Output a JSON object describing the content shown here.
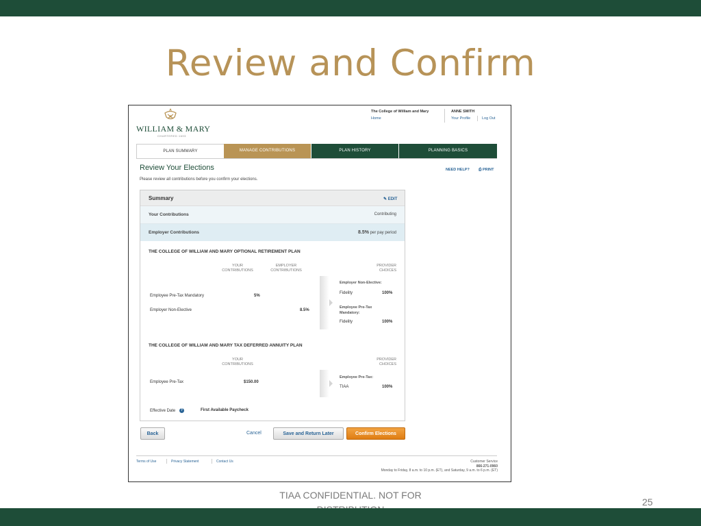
{
  "slide": {
    "title": "Review and Confirm",
    "footer": "TIAA CONFIDENTIAL. NOT FOR DISTRIBUTION",
    "page_number": "25",
    "colors": {
      "green": "#1e4d38",
      "gold": "#b79358",
      "orange": "#df7d12"
    }
  },
  "site": {
    "logo_text": "WILLIAM & MARY",
    "logo_sub": "CHARTERED 1693",
    "institution": "The College of William and Mary",
    "home_link": "Home",
    "user_name": "ANNE SMITH",
    "profile_link": "Your Profile",
    "logout_link": "Log Out"
  },
  "tabs": [
    {
      "label": "PLAN SUMMARY"
    },
    {
      "label": "MANAGE CONTRIBUTIONS"
    },
    {
      "label": "PLAN HISTORY"
    },
    {
      "label": "PLANNING BASICS"
    }
  ],
  "page": {
    "title": "Review Your Elections",
    "subtitle": "Please review all contributions before you confirm your elections.",
    "need_help": "NEED HELP?",
    "print": "PRINT"
  },
  "summary": {
    "title": "Summary",
    "edit": "EDIT",
    "your_contrib_label": "Your Contributions",
    "your_contrib_value": "Contributing",
    "employer_contrib_label": "Employer Contributions",
    "employer_contrib_value": "8.5%",
    "employer_contrib_suffix": "per pay period"
  },
  "plan1": {
    "title": "THE COLLEGE OF WILLIAM AND MARY OPTIONAL RETIREMENT PLAN",
    "col_your": "YOUR CONTRIBUTIONS",
    "col_employer": "EMPLOYER CONTRIBUTIONS",
    "col_provider": "PROVIDER CHOICES",
    "row1_label": "Employee Pre-Tax Mandatory",
    "row1_your": "5%",
    "row2_label": "Employer Non-Elective",
    "row2_employer": "8.5%",
    "prov1_heading": "Employer Non-Elective:",
    "prov1_name": "Fidelity",
    "prov1_pct": "100%",
    "prov2_heading": "Employee Pre-Tax Mandatory:",
    "prov2_name": "Fidelity",
    "prov2_pct": "100%"
  },
  "plan2": {
    "title": "THE COLLEGE OF WILLIAM AND MARY TAX DEFERRED ANNUITY PLAN",
    "col_your": "YOUR CONTRIBUTIONS",
    "col_provider": "PROVIDER CHOICES",
    "row1_label": "Employee Pre-Tax",
    "row1_your": "$150.00",
    "prov1_heading": "Employee Pre-Tax:",
    "prov1_name": "TIAA",
    "prov1_pct": "100%"
  },
  "effective": {
    "label": "Effective Date",
    "value": "First Available Paycheck"
  },
  "buttons": {
    "back": "Back",
    "cancel": "Cancel",
    "save": "Save and Return Later",
    "confirm": "Confirm Elections"
  },
  "footer": {
    "terms": "Terms of Use",
    "privacy": "Privacy Statement",
    "contact": "Contact Us",
    "cs_title": "Customer Service",
    "cs_phone": "866-271-0960",
    "cs_hours": "Monday to Friday, 8 a.m. to 10 p.m. (ET), and Saturday, 9 a.m. to 6 p.m. (ET)"
  }
}
